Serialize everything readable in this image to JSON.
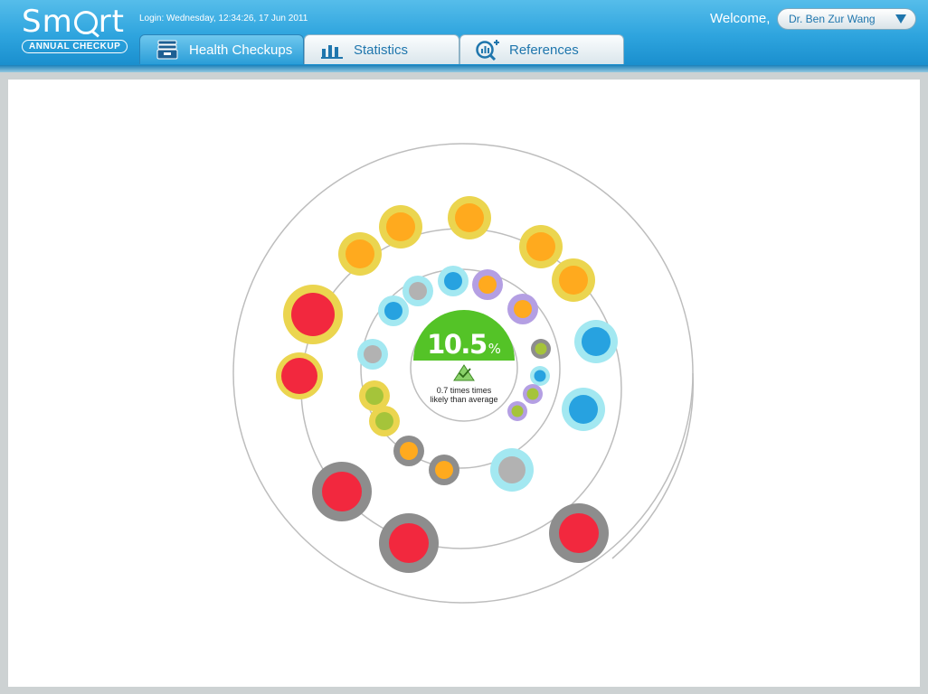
{
  "app": {
    "logo_main": "Sm",
    "logo_tail": "rt",
    "logo_sub": "ANNUAL CHECKUP",
    "login": "Login: Wednesday, 12:34:26, 17 Jun 2011"
  },
  "tabs": [
    {
      "label": "Health Checkups",
      "icon": "stack-icon",
      "active": true
    },
    {
      "label": "Statistics",
      "icon": "bar-chart-icon",
      "active": false
    },
    {
      "label": "References",
      "icon": "magnifier-chart-icon",
      "active": false
    }
  ],
  "user": {
    "welcome": "Welcome,",
    "name": "Dr. Ben Zur Wang"
  },
  "risk": {
    "value": "10.5",
    "unit": "%",
    "relative_line1": "0.7 times times",
    "relative_line2": "likely than average",
    "status_icon": "check-triangle-icon"
  },
  "colors": {
    "accent": "#2ea4de",
    "risk_green": "#54c327",
    "red": "#f2283e",
    "orange": "#ffaa1e",
    "yellow_ring": "#ebd54f",
    "cyan_ring": "#a3e8f1",
    "blue": "#27a2e0",
    "grey_ring": "#8d8d8d",
    "purple_ring": "#b49fe3",
    "olive": "#a5c43a"
  }
}
